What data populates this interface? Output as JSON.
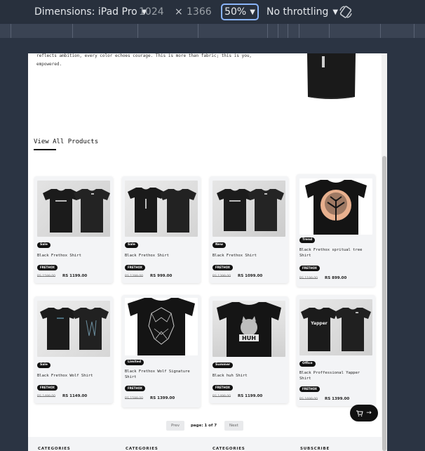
{
  "devtools": {
    "device_label": "Dimensions: iPad Pro",
    "width": "1024",
    "times": "×",
    "height": "1366",
    "zoom": "50%",
    "throttling": "No throttling"
  },
  "page": {
    "intro_text": "reflects ambition, every color echoes courage. This is more than fabric; this is you, empowered.",
    "view_all_label": "View All Products",
    "products": [
      {
        "badge": "Sale",
        "name": "Black Frethox Shirt",
        "brand": "FRETHOX",
        "old_price": "RS 1599.00",
        "price": "RS 1199.00"
      },
      {
        "badge": "Sale",
        "name": "Black Frethox Shirt",
        "brand": "FRETHOX",
        "old_price": "RS 1299.00",
        "price": "RS 999.00"
      },
      {
        "badge": "New",
        "name": "Black Frethox Shirt",
        "brand": "FRETHOX",
        "old_price": "RS 1399.00",
        "price": "RS 1099.00"
      },
      {
        "badge": "Trend",
        "name": "Black Frethox spritual tree Shirt",
        "brand": "FRETHOX",
        "old_price": "RS 1199.00",
        "price": "RS 899.00"
      },
      {
        "badge": "Sale",
        "name": "Black Frethox Wolf Shirt",
        "brand": "FRETHOX",
        "old_price": "RS 1499.00",
        "price": "RS 1149.00"
      },
      {
        "badge": "Limited",
        "name": "Black Frethox Wolf Signature Shirt",
        "brand": "FRETHOX",
        "old_price": "RS 1599.00",
        "price": "RS 1399.00"
      },
      {
        "badge": "Summer",
        "name": "Black huh Shirt",
        "brand": "FRETHOX",
        "old_price": "RS 1499.00",
        "price": "RS 1199.00"
      },
      {
        "badge": "Office",
        "name": "Black Proffessional Yapper Shirt",
        "brand": "FRETHOX",
        "old_price": "RS 1699.00",
        "price": "RS 1399.00"
      }
    ],
    "pagination": {
      "prev": "Prev",
      "info": "page: 1 of 7",
      "next": "Next"
    },
    "footer_headings": [
      "CATEGORIES",
      "CATEGORIES",
      "CATEGORIES",
      "SUBSCRIBE"
    ],
    "cart_arrow": "→",
    "cat_graphic_text": "HUH",
    "yapper_graphic_text": "Yapper"
  },
  "colors": {
    "accent": "#8ab4f8",
    "toolbar_bg": "#28303d",
    "page_bg": "#2b3443",
    "badge_bg": "#111111"
  }
}
